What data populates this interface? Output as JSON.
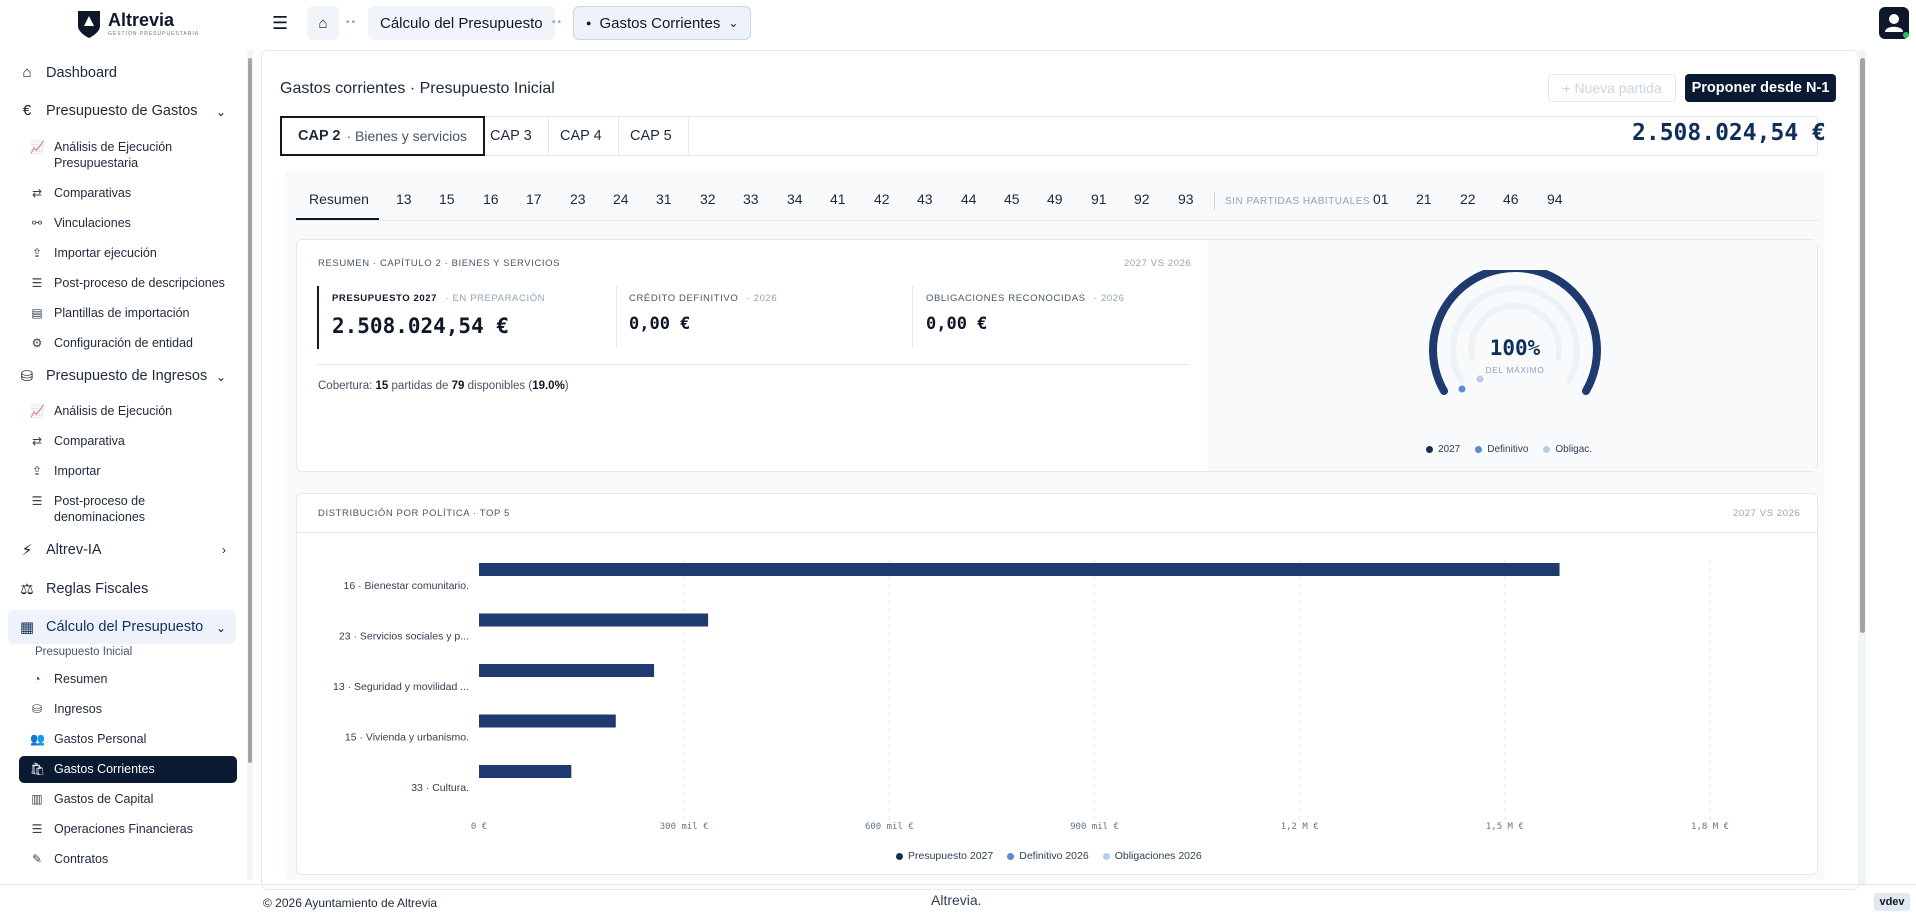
{
  "brand": {
    "name": "Altrevia",
    "tagline": "GESTIÓN PRESUPUESTARIA"
  },
  "header": {
    "breadcrumb": [
      "Cálculo del Presupuesto",
      "Gastos Corrientes"
    ]
  },
  "sidebar": {
    "dashboard": "Dashboard",
    "gastos": {
      "label": "Presupuesto de Gastos",
      "items": [
        "Análisis de Ejecución Presupuestaria",
        "Comparativas",
        "Vinculaciones",
        "Importar ejecución",
        "Post-proceso de descripciones",
        "Plantillas de importación",
        "Configuración de entidad"
      ]
    },
    "ingresos": {
      "label": "Presupuesto de Ingresos",
      "items": [
        "Análisis de Ejecución",
        "Comparativa",
        "Importar",
        "Post-proceso de denominaciones"
      ]
    },
    "ia": "Altrev-IA",
    "reglas": "Reglas Fiscales",
    "calculo": {
      "label": "Cálculo del Presupuesto",
      "section": "Presupuesto Inicial",
      "items": [
        "Resumen",
        "Ingresos",
        "Gastos Personal",
        "Gastos Corrientes",
        "Gastos de Capital",
        "Operaciones Financieras",
        "Contratos"
      ]
    }
  },
  "page": {
    "title": "Gastos corrientes · Presupuesto Inicial",
    "btn_new": "+ Nueva partida",
    "btn_propose": "Proponer desde N-1",
    "cap_tabs": [
      {
        "label": "CAP 2",
        "sub": "· Bienes y servicios"
      },
      {
        "label": "CAP 3"
      },
      {
        "label": "CAP 4"
      },
      {
        "label": "CAP 5"
      }
    ],
    "total": "2.508.024,54 €",
    "sub_tabs": [
      "Resumen",
      "13",
      "15",
      "16",
      "17",
      "23",
      "24",
      "31",
      "32",
      "33",
      "34",
      "41",
      "42",
      "43",
      "44",
      "45",
      "49",
      "91",
      "92",
      "93"
    ],
    "sin_partidas_label": "SIN PARTIDAS HABITUALES",
    "sin_partidas": [
      "01",
      "21",
      "22",
      "46",
      "94"
    ]
  },
  "summary": {
    "heading": "RESUMEN · CAPÍTULO 2 · BIENES Y SERVICIOS",
    "compare": "2027 VS 2026",
    "kpis": [
      {
        "label": "PRESUPUESTO 2027",
        "sub": "· EN PREPARACIÓN",
        "value": "2.508.024,54 €"
      },
      {
        "label": "CRÉDITO DEFINITIVO",
        "sub": "· 2026",
        "value": "0,00 €"
      },
      {
        "label": "OBLIGACIONES RECONOCIDAS",
        "sub": "· 2026",
        "value": "0,00 €"
      }
    ],
    "coverage": {
      "prefix": "Cobertura: ",
      "n": "15",
      "mid": " partidas de ",
      "total": "79",
      "suffix": " disponibles (",
      "pct": "19.0%",
      "end": ")"
    },
    "gauge": {
      "value_text": "100%",
      "value_label": "DEL MÁXIMO",
      "percent": 100,
      "legend": [
        "2027",
        "Definitivo",
        "Obligac."
      ]
    }
  },
  "colors": {
    "dark": "#1e3a6e",
    "mid": "#5b8ad6",
    "light": "#b8cce8"
  },
  "chart_data": {
    "type": "bar",
    "title": "DISTRIBUCIÓN POR POLÍTICA · TOP 5",
    "subtitle": "2027 VS 2026",
    "categories": [
      "16 · Bienestar comunitario.",
      "23 · Servicios sociales y p...",
      "13 · Seguridad y movilidad ...",
      "15 · Vivienda y urbanismo.",
      "33 · Cultura."
    ],
    "series": [
      {
        "name": "Presupuesto 2027",
        "values": [
          1580000,
          335000,
          256000,
          200000,
          135000
        ]
      },
      {
        "name": "Definitivo 2026",
        "values": [
          0,
          0,
          0,
          0,
          0
        ]
      },
      {
        "name": "Obligaciones 2026",
        "values": [
          0,
          0,
          0,
          0,
          0
        ]
      }
    ],
    "xlim": [
      0,
      1800000
    ],
    "x_ticks": [
      "0 €",
      "300 mil €",
      "600 mil €",
      "900 mil €",
      "1,2 M €",
      "1,5 M €",
      "1,8 M €"
    ],
    "legend_position": "bottom"
  },
  "footer": {
    "copyright": "© 2026 Ayuntamiento de Altrevia",
    "center": "Altrevia.",
    "version": "vdev"
  }
}
